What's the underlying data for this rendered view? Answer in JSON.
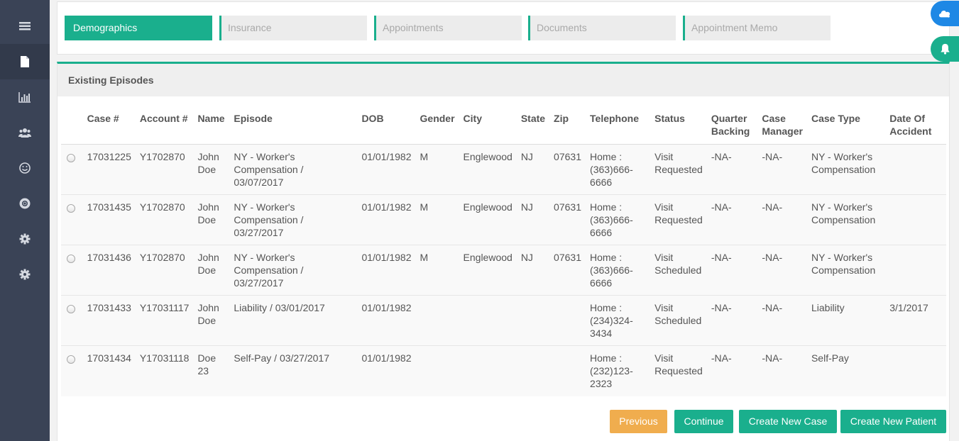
{
  "sidebar": {
    "items": [
      {
        "icon": "list-icon"
      },
      {
        "icon": "document-icon"
      },
      {
        "icon": "bar-chart-icon"
      },
      {
        "icon": "users-icon"
      },
      {
        "icon": "smile-icon"
      },
      {
        "icon": "lifesaver-icon"
      },
      {
        "icon": "gear-icon"
      },
      {
        "icon": "gear-icon"
      }
    ]
  },
  "tabs": [
    "Demographics",
    "Insurance",
    "Appointments",
    "Documents",
    "Appointment Memo"
  ],
  "fabs": {
    "top": "cloud-icon",
    "bottom": "bell-icon"
  },
  "card": {
    "title": "Existing Episodes"
  },
  "table": {
    "headers": [
      "Case #",
      "Account #",
      "Name",
      "Episode",
      "DOB",
      "Gender",
      "City",
      "State",
      "Zip",
      "Telephone",
      "Status",
      "Quarter Backing",
      "Case Manager",
      "Case Type",
      "Date Of Accident"
    ],
    "rows": [
      {
        "case": "17031225",
        "account": "Y1702870",
        "name": "John Doe",
        "episode": "NY - Worker's Compensation / 03/07/2017",
        "dob": "01/01/1982",
        "gender": "M",
        "city": "Englewood",
        "state": "NJ",
        "zip": "07631",
        "telephone": "Home : (363)666-6666",
        "status": "Visit Requested",
        "qb": "-NA-",
        "cm": "-NA-",
        "type": "NY - Worker's Compensation",
        "doa": ""
      },
      {
        "case": "17031435",
        "account": "Y1702870",
        "name": "John Doe",
        "episode": "NY - Worker's Compensation / 03/27/2017",
        "dob": "01/01/1982",
        "gender": "M",
        "city": "Englewood",
        "state": "NJ",
        "zip": "07631",
        "telephone": "Home : (363)666-6666",
        "status": "Visit Requested",
        "qb": "-NA-",
        "cm": "-NA-",
        "type": "NY - Worker's Compensation",
        "doa": ""
      },
      {
        "case": "17031436",
        "account": "Y1702870",
        "name": "John Doe",
        "episode": "NY - Worker's Compensation / 03/27/2017",
        "dob": "01/01/1982",
        "gender": "M",
        "city": "Englewood",
        "state": "NJ",
        "zip": "07631",
        "telephone": "Home : (363)666-6666",
        "status": "Visit Scheduled",
        "qb": "-NA-",
        "cm": "-NA-",
        "type": "NY - Worker's Compensation",
        "doa": ""
      },
      {
        "case": "17031433",
        "account": "Y17031117",
        "name": "John Doe",
        "episode": "Liability / 03/01/2017",
        "dob": "01/01/1982",
        "gender": "",
        "city": "",
        "state": "",
        "zip": "",
        "telephone": "Home : (234)324-3434",
        "status": "Visit Scheduled",
        "qb": "-NA-",
        "cm": "-NA-",
        "type": "Liability",
        "doa": "3/1/2017"
      },
      {
        "case": "17031434",
        "account": "Y17031118",
        "name": "Doe 23",
        "episode": "Self-Pay / 03/27/2017",
        "dob": "01/01/1982",
        "gender": "",
        "city": "",
        "state": "",
        "zip": "",
        "telephone": "Home : (232)123-2323",
        "status": "Visit Requested",
        "qb": "-NA-",
        "cm": "-NA-",
        "type": "Self-Pay",
        "doa": ""
      }
    ]
  },
  "buttons": {
    "previous": "Previous",
    "continue": "Continue",
    "create_case": "Create New Case",
    "create_patient": "Create New Patient"
  },
  "colors": {
    "accent": "#1aaf8d",
    "sidebar": "#3a4356",
    "warning": "#f0ad4e",
    "info": "#1e88e5"
  }
}
